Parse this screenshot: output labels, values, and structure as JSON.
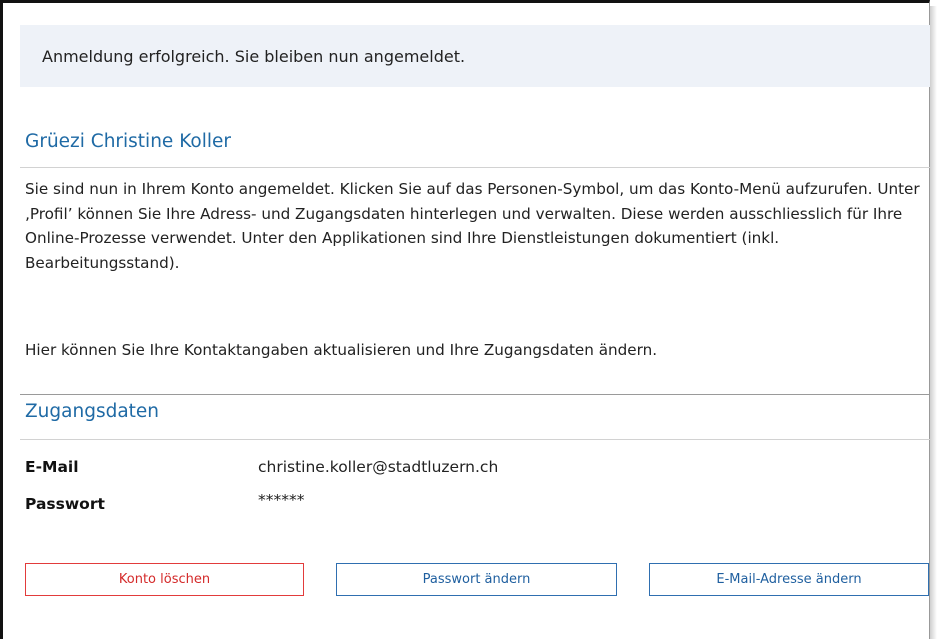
{
  "notice": {
    "text": "Anmeldung erfolgreich. Sie bleiben nun angemeldet."
  },
  "greeting": {
    "title": "Grüezi Christine Koller",
    "intro": "Sie sind nun in Ihrem Konto angemeldet. Klicken Sie auf das Personen-Symbol, um das Konto-Menü aufzurufen. Unter ‚Profil’ können Sie Ihre Adress- und Zugangsdaten hinterlegen und verwalten. Diese werden ausschliesslich für Ihre Online-Prozesse verwendet. Unter den Applikationen sind Ihre Dienstleistungen dokumentiert (inkl. Bearbeitungsstand).",
    "hint": "Hier können Sie Ihre Kontaktangaben aktualisieren und Ihre Zugangsdaten ändern."
  },
  "credentials": {
    "title": "Zugangsdaten",
    "email_label": "E-Mail",
    "email_value": "christine.koller@stadtluzern.ch",
    "password_label": "Passwort",
    "password_value": "******"
  },
  "actions": {
    "delete_account": "Konto löschen",
    "change_password": "Passwort ändern",
    "change_email": "E-Mail-Adresse ändern"
  },
  "colors": {
    "accent": "#1f6aa5",
    "danger": "#e23b3b",
    "notice_bg": "#eef2f8"
  }
}
